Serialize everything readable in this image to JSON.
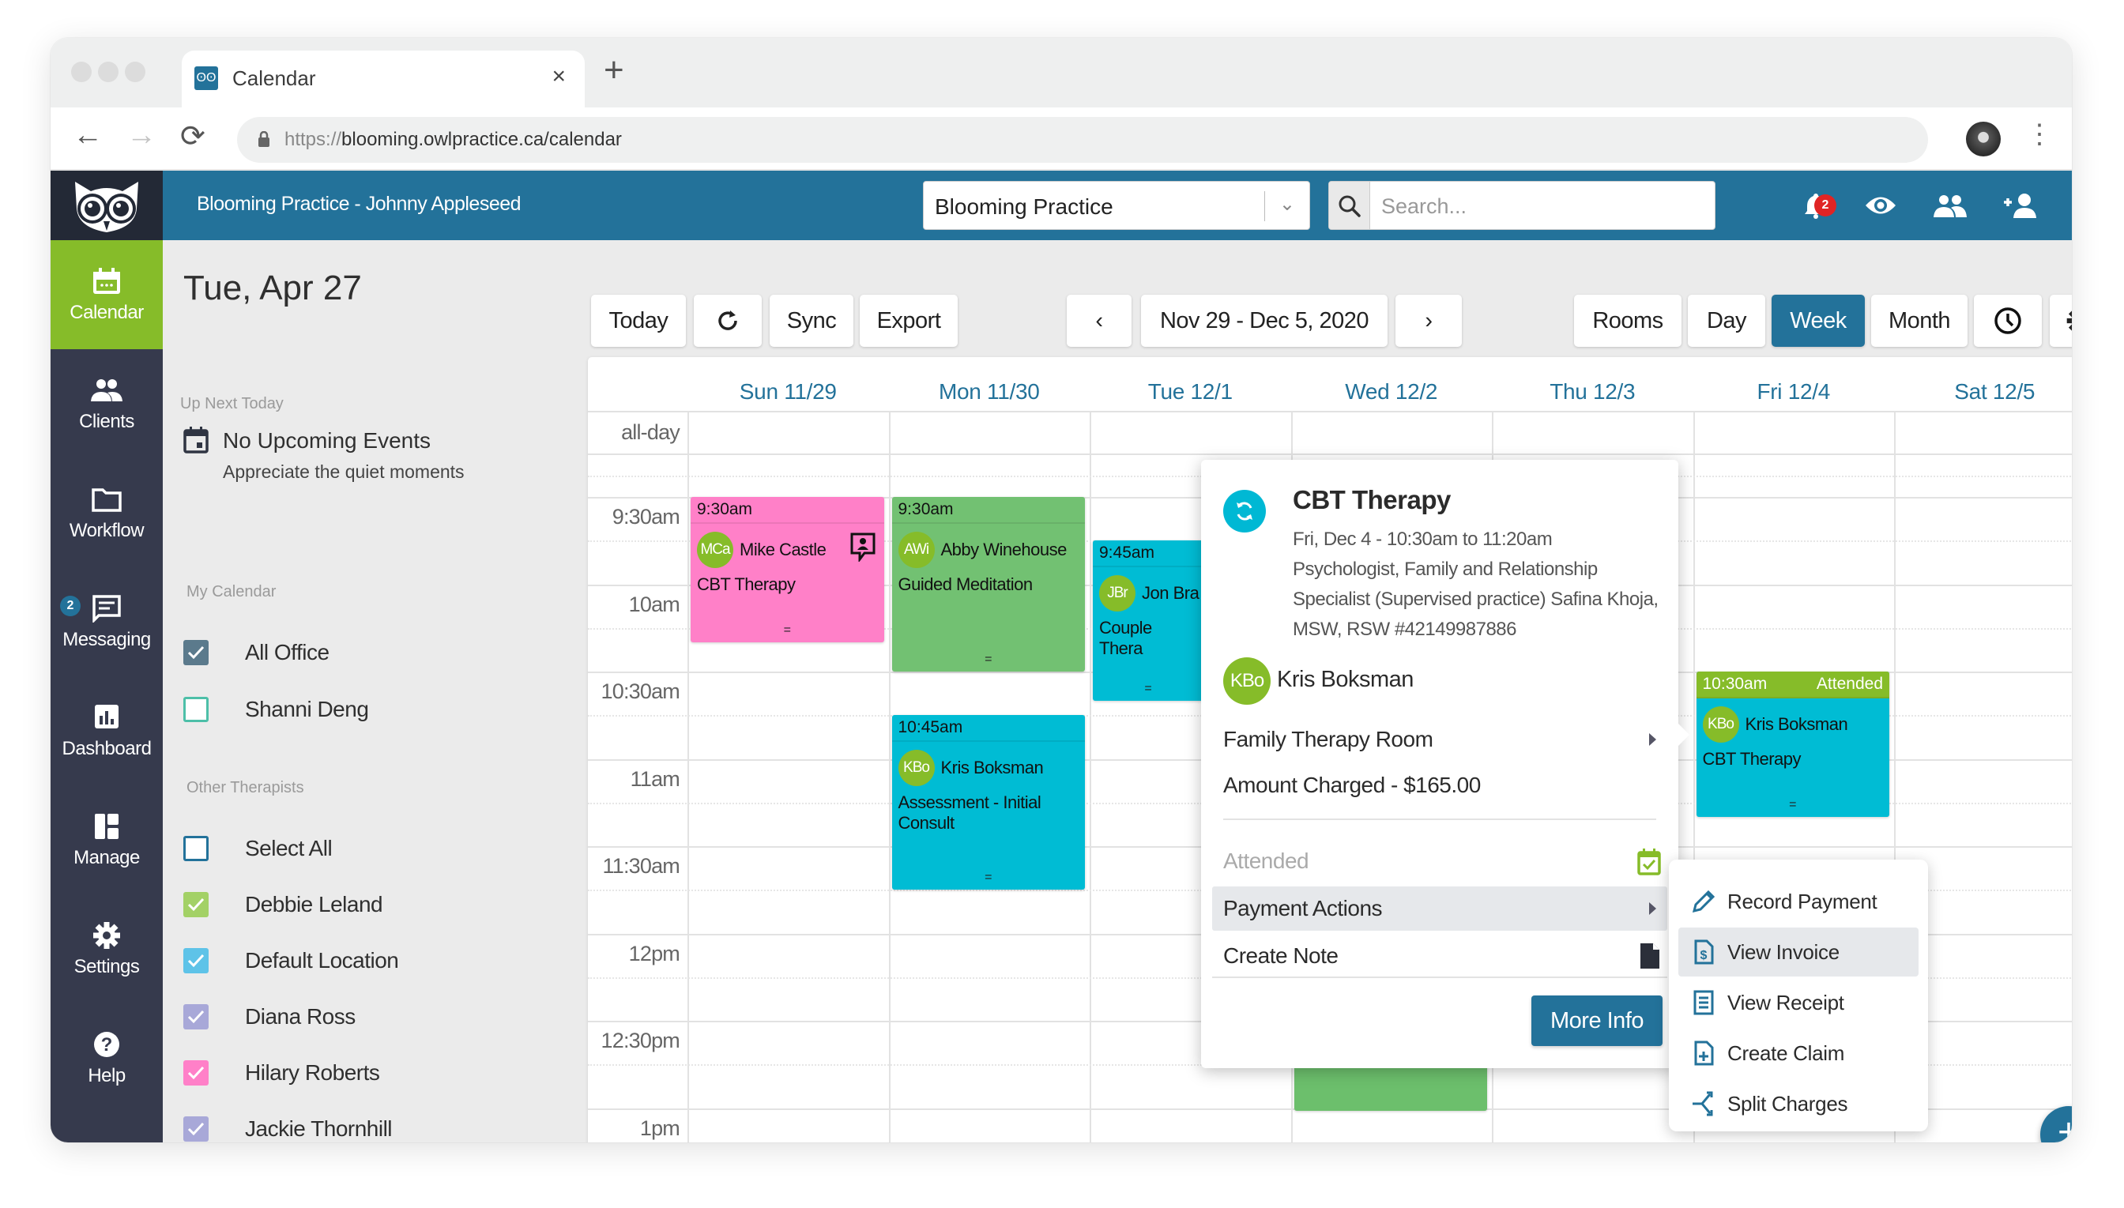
{
  "browser": {
    "tab_title": "Calendar",
    "url_protocol": "https://",
    "url_rest": "blooming.owlpractice.ca/calendar"
  },
  "header": {
    "practice_title": "Blooming Practice - Johnny Appleseed",
    "practice_select_value": "Blooming Practice",
    "search_placeholder": "Search...",
    "notification_count": "2",
    "icons": [
      "bell-icon",
      "eye-icon",
      "group-icon",
      "add-person-icon",
      "more-vertical-icon"
    ]
  },
  "nav": {
    "items": [
      {
        "label": "Calendar",
        "icon": "calendar-icon",
        "active": true
      },
      {
        "label": "Clients",
        "icon": "people-icon"
      },
      {
        "label": "Workflow",
        "icon": "folder-icon"
      },
      {
        "label": "Messaging",
        "icon": "message-icon",
        "badge": "2"
      },
      {
        "label": "Dashboard",
        "icon": "chart-icon"
      },
      {
        "label": "Manage",
        "icon": "dashboard-tiles-icon"
      },
      {
        "label": "Settings",
        "icon": "gear-icon"
      },
      {
        "label": "Help",
        "icon": "help-icon"
      }
    ]
  },
  "sidepanel": {
    "date": "Tue, Apr 27",
    "up_next_label": "Up Next Today",
    "no_events": "No Upcoming Events",
    "no_events_sub": "Appreciate the quiet moments",
    "my_calendar_label": "My Calendar",
    "my_calendar": [
      {
        "label": "All Office",
        "checked": true,
        "color": "#5b7a8c"
      },
      {
        "label": "Shanni Deng",
        "checked": false,
        "color": "#4dbfa8"
      }
    ],
    "other_therapists_label": "Other Therapists",
    "other_therapists": [
      {
        "label": "Select All",
        "checked": false,
        "color": "#23729a"
      },
      {
        "label": "Debbie Leland",
        "checked": true,
        "color": "#a3d166"
      },
      {
        "label": "Default Location",
        "checked": true,
        "color": "#5ec3e8"
      },
      {
        "label": "Diana Ross",
        "checked": true,
        "color": "#a8a8d8"
      },
      {
        "label": "Hilary Roberts",
        "checked": true,
        "color": "#ff80c8"
      },
      {
        "label": "Jackie Thornhill",
        "checked": true,
        "color": "#a8a8d8"
      }
    ]
  },
  "toolbar": {
    "today": "Today",
    "sync": "Sync",
    "export": "Export",
    "date_range": "Nov 29 - Dec 5, 2020",
    "prev": "‹",
    "next": "›",
    "rooms": "Rooms",
    "day": "Day",
    "week": "Week",
    "month": "Month",
    "active_view": "Week"
  },
  "calendar": {
    "days": [
      "Sun 11/29",
      "Mon 11/30",
      "Tue 12/1",
      "Wed 12/2",
      "Thu 12/3",
      "Fri 12/4",
      "Sat 12/5"
    ],
    "allday_label": "all-day",
    "time_labels": [
      "9:30am",
      "10am",
      "10:30am",
      "11am",
      "11:30am",
      "12pm",
      "12:30pm",
      "1pm"
    ],
    "events": [
      {
        "day": 0,
        "time": "9:30am",
        "client_initials": "MCa",
        "client": "Mike Castle",
        "service": "CBT Therapy",
        "color": "#ff80c8",
        "has_video_icon": true
      },
      {
        "day": 1,
        "time": "9:30am",
        "client_initials": "AWi",
        "client": "Abby Winehouse",
        "service": "Guided Meditation",
        "color": "#72c172"
      },
      {
        "day": 2,
        "time": "9:45am",
        "client_initials": "JBr",
        "client": "Jon Bra",
        "service": "Couple Thera",
        "color": "#00bcd4"
      },
      {
        "day": 1,
        "time": "10:45am",
        "client_initials": "KBo",
        "client": "Kris Boksman",
        "service": "Assessment - Initial Consult",
        "color": "#00bcd4"
      },
      {
        "day": 5,
        "time": "10:30am",
        "status": "Attended",
        "client_initials": "KBo",
        "client": "Kris Boksman",
        "service": "CBT Therapy",
        "color": "#00bcd4",
        "status_color": "#86bc29"
      }
    ]
  },
  "popover": {
    "title": "CBT Therapy",
    "when": "Fri, Dec 4 - 10:30am to 11:20am",
    "therapist": "Psychologist, Family and Relationship Specialist (Supervised practice) Safina Khoja, MSW, RSW #42149987886",
    "client_initials": "KBo",
    "client": "Kris Boksman",
    "room": "Family Therapy Room",
    "amount": "Amount Charged - $165.00",
    "attended_label": "Attended",
    "payment_actions": "Payment Actions",
    "create_note": "Create Note",
    "more_info": "More Info"
  },
  "submenu": {
    "items": [
      {
        "label": "Record Payment",
        "icon": "pencil-icon"
      },
      {
        "label": "View Invoice",
        "icon": "invoice-icon",
        "hover": true
      },
      {
        "label": "View Receipt",
        "icon": "receipt-icon"
      },
      {
        "label": "Create Claim",
        "icon": "file-plus-icon"
      },
      {
        "label": "Split Charges",
        "icon": "split-icon"
      }
    ]
  },
  "fab_label": "+"
}
